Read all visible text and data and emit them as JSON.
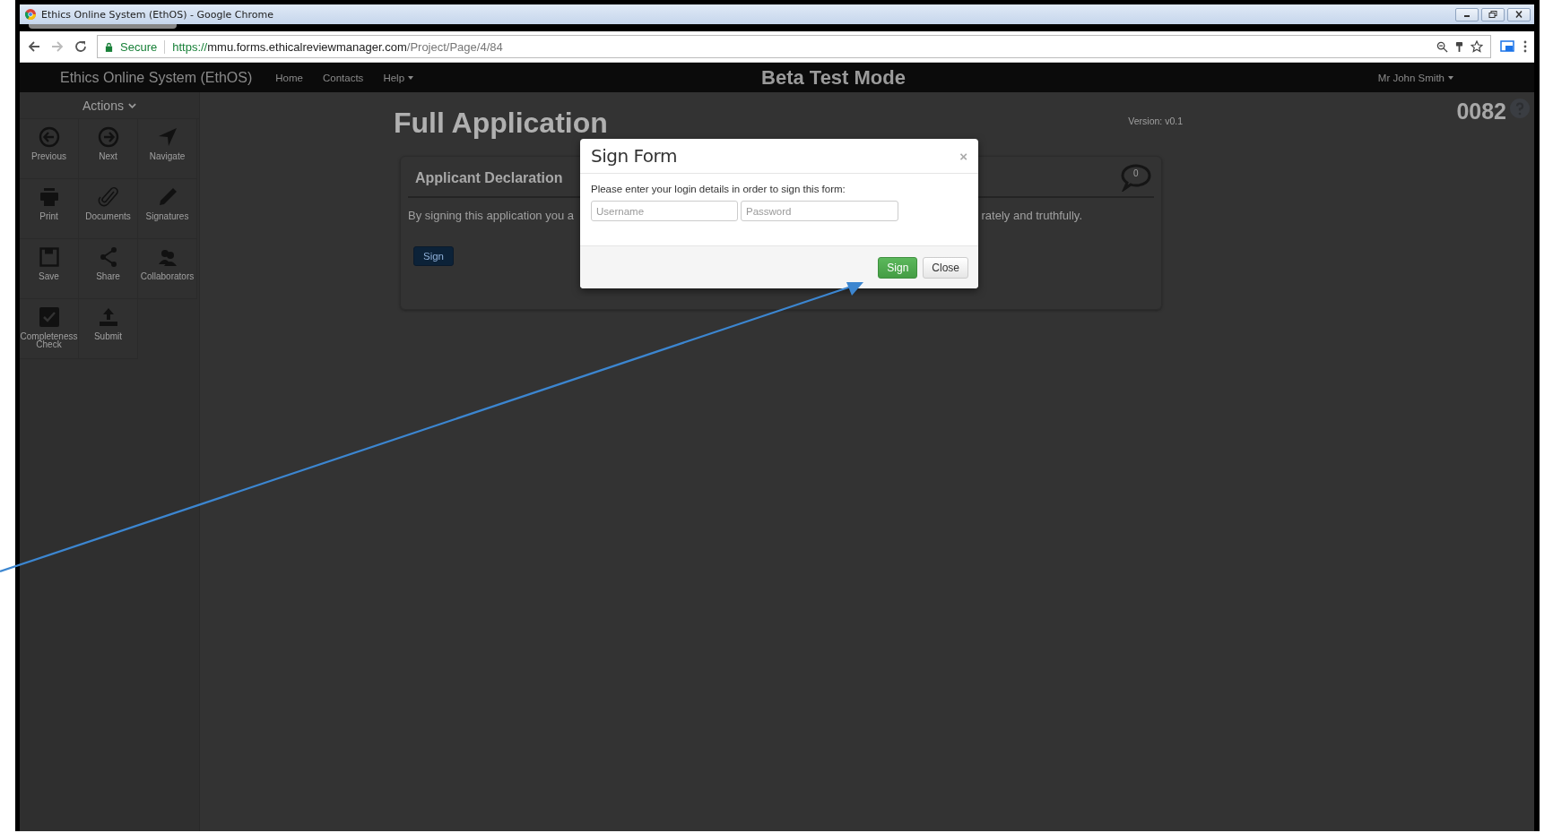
{
  "browser": {
    "title": "Ethics Online System (EthOS) - Google Chrome",
    "secure_label": "Secure",
    "url_scheme": "https://",
    "url_host": "mmu.forms.ethicalreviewmanager.com",
    "url_path": "/Project/Page/4/84"
  },
  "navbar": {
    "brand": "Ethics Online System (EthOS)",
    "links": [
      {
        "label": "Home",
        "dropdown": false
      },
      {
        "label": "Contacts",
        "dropdown": false
      },
      {
        "label": "Help",
        "dropdown": true
      }
    ],
    "mode": "Beta Test Mode",
    "user": "Mr John Smith"
  },
  "sidebar": {
    "header": "Actions",
    "actions": [
      {
        "label": "Previous"
      },
      {
        "label": "Next"
      },
      {
        "label": "Navigate"
      },
      {
        "label": "Print"
      },
      {
        "label": "Documents"
      },
      {
        "label": "Signatures"
      },
      {
        "label": "Save"
      },
      {
        "label": "Share"
      },
      {
        "label": "Collaborators"
      },
      {
        "label": "Completeness Check"
      },
      {
        "label": "Submit"
      }
    ]
  },
  "page": {
    "title": "Full Application",
    "version": "Version: v0.1",
    "number": "0082"
  },
  "panel": {
    "title": "Applicant Declaration",
    "comment_count": "0",
    "text_start": "By signing this application you a",
    "text_end": "rately and truthfully.",
    "button": "Sign"
  },
  "dialog": {
    "title": "Sign Form",
    "close_glyph": "×",
    "prompt": "Please enter your login details in order to sign this form:",
    "fields": [
      {
        "placeholder": "Username"
      },
      {
        "placeholder": "Password"
      }
    ],
    "buttons": [
      {
        "label": "Sign",
        "kind": "primary"
      },
      {
        "label": "Close",
        "kind": "default"
      }
    ]
  }
}
